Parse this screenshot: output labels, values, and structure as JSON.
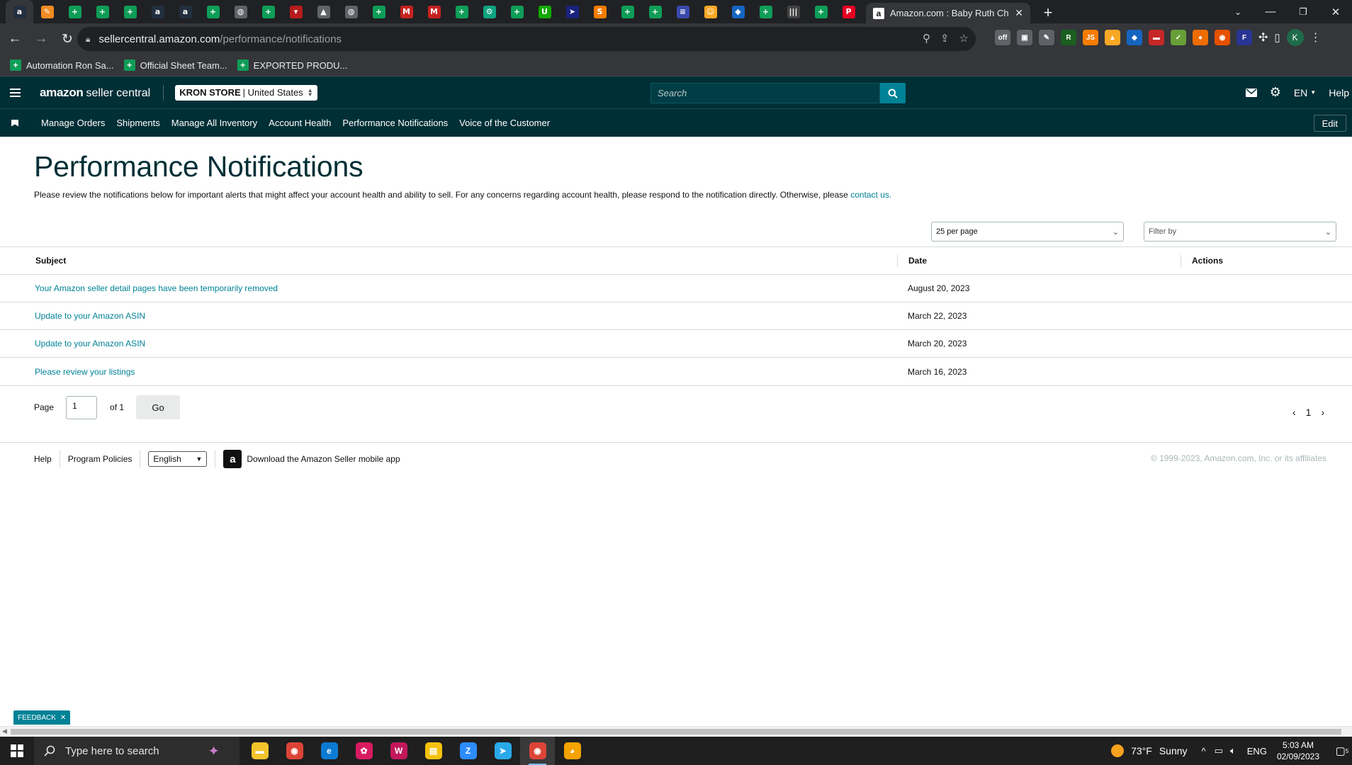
{
  "browser": {
    "pinned_tab_icons": [
      {
        "name": "amazon-tab-icon",
        "glyph": "a",
        "color": "#232f3e"
      },
      {
        "name": "pencil-tab-icon",
        "glyph": "✎",
        "color": "#f28b24"
      },
      {
        "name": "sheets-tab-icon",
        "glyph": "+",
        "color": "#0f9d58"
      },
      {
        "name": "sheets-tab-icon",
        "glyph": "+",
        "color": "#0f9d58"
      },
      {
        "name": "sheets-tab-icon",
        "glyph": "+",
        "color": "#0f9d58"
      },
      {
        "name": "amazon-tab-icon",
        "glyph": "a",
        "color": "#232f3e"
      },
      {
        "name": "amazon-tab-icon",
        "glyph": "a",
        "color": "#232f3e"
      },
      {
        "name": "sheets-tab-icon",
        "glyph": "+",
        "color": "#0f9d58"
      },
      {
        "name": "globe-tab-icon",
        "glyph": "◍",
        "color": "#5f6368"
      },
      {
        "name": "sheets-tab-icon",
        "glyph": "+",
        "color": "#0f9d58"
      },
      {
        "name": "flag-tab-icon",
        "glyph": "▾",
        "color": "#b71c1c"
      },
      {
        "name": "triangle-tab-icon",
        "glyph": "▲",
        "color": "#5f6368"
      },
      {
        "name": "globe-tab-icon",
        "glyph": "◍",
        "color": "#5f6368"
      },
      {
        "name": "sheets-tab-icon",
        "glyph": "+",
        "color": "#0f9d58"
      },
      {
        "name": "gmail-tab-icon",
        "glyph": "M",
        "color": "#c5221f"
      },
      {
        "name": "gmail-tab-icon",
        "glyph": "M",
        "color": "#c5221f"
      },
      {
        "name": "sheets-tab-icon",
        "glyph": "+",
        "color": "#0f9d58"
      },
      {
        "name": "chatgpt-tab-icon",
        "glyph": "⚙",
        "color": "#10a37f"
      },
      {
        "name": "sheets-tab-icon",
        "glyph": "+",
        "color": "#0f9d58"
      },
      {
        "name": "upwork-tab-icon",
        "glyph": "U",
        "color": "#14a800"
      },
      {
        "name": "send-tab-icon",
        "glyph": "➤",
        "color": "#1a237e"
      },
      {
        "name": "orange-circle-tab-icon",
        "glyph": "S",
        "color": "#f57c00"
      },
      {
        "name": "sheets-tab-icon",
        "glyph": "+",
        "color": "#0f9d58"
      },
      {
        "name": "sheets-tab-icon",
        "glyph": "+",
        "color": "#0f9d58"
      },
      {
        "name": "flag-us-tab-icon",
        "glyph": "≡",
        "color": "#3949ab"
      },
      {
        "name": "smile-tab-icon",
        "glyph": "☺",
        "color": "#f9a825"
      },
      {
        "name": "blue-diamond-tab-icon",
        "glyph": "◆",
        "color": "#1565c0"
      },
      {
        "name": "sheets-tab-icon",
        "glyph": "+",
        "color": "#0f9d58"
      },
      {
        "name": "barcode-tab-icon",
        "glyph": "|||",
        "color": "#424242"
      },
      {
        "name": "sheets-tab-icon",
        "glyph": "+",
        "color": "#0f9d58"
      },
      {
        "name": "pinterest-tab-icon",
        "glyph": "P",
        "color": "#e60023"
      }
    ],
    "active_tab_title": "Amazon.com : Baby Ruth Chocol",
    "url_domain": "sellercentral.amazon.com",
    "url_path": "/performance/notifications",
    "bookmarks": [
      "Automation Ron Sa...",
      "Official Sheet Team...",
      "EXPORTED PRODU..."
    ],
    "extensions": [
      {
        "name": "off-extension-icon",
        "glyph": "off",
        "color": "#5f6368"
      },
      {
        "name": "image-extension-icon",
        "glyph": "▣",
        "color": "#5f6368"
      },
      {
        "name": "edit-extension-icon",
        "glyph": "✎",
        "color": "#5f6368"
      },
      {
        "name": "r-extension-icon",
        "glyph": "R",
        "color": "#1b5e20"
      },
      {
        "name": "js-extension-icon",
        "glyph": "JS",
        "color": "#f57c00"
      },
      {
        "name": "chart-extension-icon",
        "glyph": "▲",
        "color": "#f9a825"
      },
      {
        "name": "blue-diamond-extension-icon",
        "glyph": "◆",
        "color": "#1565c0"
      },
      {
        "name": "red-extension-icon",
        "glyph": "▬",
        "color": "#c62828"
      },
      {
        "name": "green-extension-icon",
        "glyph": "✓",
        "color": "#689f38"
      },
      {
        "name": "circle-extension-icon",
        "glyph": "●",
        "color": "#ef6c00"
      },
      {
        "name": "fox-extension-icon",
        "glyph": "◉",
        "color": "#e65100"
      },
      {
        "name": "f-extension-icon",
        "glyph": "F",
        "color": "#283593"
      }
    ],
    "profile_initial": "K"
  },
  "header": {
    "logo_bold": "amazon",
    "logo_rest": "seller central",
    "store_name": "KRON STORE",
    "store_region": "| United States",
    "search_placeholder": "Search",
    "language": "EN",
    "help": "Help"
  },
  "nav": {
    "links": [
      "Manage Orders",
      "Shipments",
      "Manage All Inventory",
      "Account Health",
      "Performance Notifications",
      "Voice of the Customer"
    ],
    "edit": "Edit"
  },
  "main": {
    "title": "Performance Notifications",
    "description": "Please review the notifications below for important alerts that might affect your account health and ability to sell. For any concerns regarding account health, please respond to the notification directly. Otherwise, please ",
    "contact_link": "contact us.",
    "per_page": "25 per page",
    "filter_placeholder": "Filter by",
    "columns": {
      "subject": "Subject",
      "date": "Date",
      "actions": "Actions"
    },
    "rows": [
      {
        "subject": "Your Amazon seller detail pages have been temporarily removed",
        "date": "August 20, 2023"
      },
      {
        "subject": "Update to your Amazon ASIN",
        "date": "March 22, 2023"
      },
      {
        "subject": "Update to your Amazon ASIN",
        "date": "March 20, 2023"
      },
      {
        "subject": "Please review your listings",
        "date": "March 16, 2023"
      }
    ],
    "pager": {
      "page_label": "Page",
      "page_value": "1",
      "of_label": "of 1",
      "go": "Go",
      "current": "1"
    }
  },
  "footer": {
    "help": "Help",
    "policies": "Program Policies",
    "language": "English",
    "app_text": "Download the Amazon Seller mobile app",
    "copyright": "© 1999-2023, Amazon.com, Inc. or its affiliates"
  },
  "feedback": "FEEDBACK",
  "taskbar": {
    "search_placeholder": "Type here to search",
    "apps": [
      {
        "name": "file-explorer-icon",
        "glyph": "▬",
        "color": "#f2c32b"
      },
      {
        "name": "chrome-icon",
        "glyph": "◉",
        "color": "#db4437"
      },
      {
        "name": "edge-icon",
        "glyph": "e",
        "color": "#0c7bd3"
      },
      {
        "name": "paint-icon",
        "glyph": "✿",
        "color": "#d81b60"
      },
      {
        "name": "wps-icon",
        "glyph": "W",
        "color": "#c2185b"
      },
      {
        "name": "sticky-notes-icon",
        "glyph": "▤",
        "color": "#f4c20d"
      },
      {
        "name": "zoom-icon",
        "glyph": "Z",
        "color": "#2d8cff"
      },
      {
        "name": "telegram-icon",
        "glyph": "➤",
        "color": "#29a9ea"
      },
      {
        "name": "chrome-profile-icon",
        "glyph": "◉",
        "color": "#db4437"
      },
      {
        "name": "app-orange-icon",
        "glyph": "◕",
        "color": "#f4a300"
      }
    ],
    "weather_temp": "73°F",
    "weather_desc": "Sunny",
    "lang": "ENG",
    "time": "5:03 AM",
    "date": "02/09/2023",
    "notification_count": "5"
  }
}
